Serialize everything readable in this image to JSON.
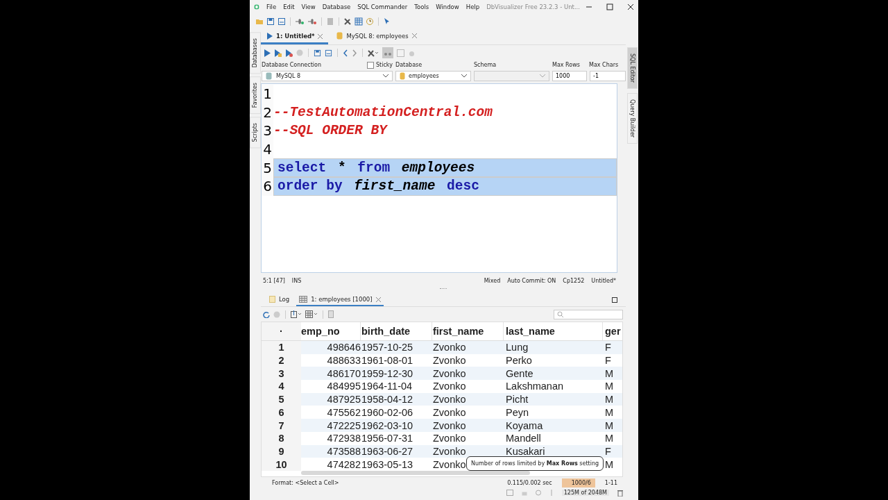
{
  "window": {
    "title": "DbVisualizer Free 23.2.3 - Unt..."
  },
  "menu": [
    "File",
    "Edit",
    "View",
    "Database",
    "SQL Commander",
    "Tools",
    "Window",
    "Help"
  ],
  "left_side_tabs": [
    {
      "label": "Databases",
      "selected": false
    },
    {
      "label": "Favorites",
      "selected": false
    },
    {
      "label": "Scripts",
      "selected": false
    }
  ],
  "right_side_tabs": [
    {
      "label": "SQL Editor",
      "selected": true
    },
    {
      "label": "Query Builder",
      "selected": false
    }
  ],
  "editor_tabs": [
    {
      "label": "1: Untitled*",
      "selected": true
    },
    {
      "label": "MySQL 8: employees",
      "selected": false
    }
  ],
  "connection": {
    "connection_label": "Database Connection",
    "connection_value": "MySQL 8",
    "sticky": {
      "label": "Sticky",
      "checked": false
    },
    "database_label": "Database",
    "database_value": "employees",
    "schema_label": "Schema",
    "max_rows_label": "Max Rows",
    "max_rows_value": "1000",
    "max_chars_label": "Max Chars",
    "max_chars_value": "-1"
  },
  "code_lines": [
    {
      "number": "1",
      "selected": false
    },
    {
      "number": "2",
      "selected": false,
      "tokens": [
        {
          "text": "--TestAutomationCentral.com",
          "kind": "comment"
        }
      ]
    },
    {
      "number": "3",
      "selected": false,
      "tokens": [
        {
          "text": "--SQL ORDER BY",
          "kind": "comment"
        }
      ]
    },
    {
      "number": "4",
      "selected": false
    },
    {
      "number": "5",
      "selected": true,
      "tokens": [
        {
          "text": "select",
          "kind": "keyword"
        },
        {
          "text": " * ",
          "kind": "plain"
        },
        {
          "text": "from",
          "kind": "keyword"
        },
        {
          "text": " employees",
          "kind": "identifier"
        }
      ]
    },
    {
      "number": "6",
      "selected": true,
      "tokens": [
        {
          "text": "order by",
          "kind": "keyword"
        },
        {
          "text": " first_name ",
          "kind": "identifier"
        },
        {
          "text": "desc",
          "kind": "keyword"
        }
      ]
    }
  ],
  "editor_status": {
    "left": [
      "5:1 [47]",
      "INS"
    ],
    "right": [
      "Mixed",
      "Auto Commit: ON",
      "Cp1252",
      "Untitled*"
    ]
  },
  "result_tabs": [
    {
      "label": "Log",
      "selected": false
    },
    {
      "label": "1: employees [1000]",
      "selected": true
    }
  ],
  "table": {
    "columns": [
      "·",
      "emp_no",
      "birth_date",
      "first_name",
      "last_name",
      "ger"
    ],
    "rows": [
      [
        "1",
        "498646",
        "1957-10-25",
        "Zvonko",
        "Lung",
        "F"
      ],
      [
        "2",
        "488633",
        "1961-08-01",
        "Zvonko",
        "Perko",
        "F"
      ],
      [
        "3",
        "486170",
        "1959-12-30",
        "Zvonko",
        "Gente",
        "M"
      ],
      [
        "4",
        "484995",
        "1964-11-04",
        "Zvonko",
        "Lakshmanan",
        "M"
      ],
      [
        "5",
        "487925",
        "1958-04-12",
        "Zvonko",
        "Picht",
        "M"
      ],
      [
        "6",
        "475562",
        "1960-02-06",
        "Zvonko",
        "Peyn",
        "M"
      ],
      [
        "7",
        "472225",
        "1962-03-10",
        "Zvonko",
        "Koyama",
        "M"
      ],
      [
        "8",
        "472938",
        "1956-07-31",
        "Zvonko",
        "Mandell",
        "M"
      ],
      [
        "9",
        "473588",
        "1963-06-27",
        "Zvonko",
        "Kusakari",
        "F"
      ],
      [
        "10",
        "474282",
        "1963-05-13",
        "Zvonko",
        "",
        "M"
      ]
    ]
  },
  "tooltip": "Number of rows limited by **Max Rows** setting",
  "status_bar": {
    "format": "Format: <Select a Cell>",
    "time": "0.115/0.002 sec",
    "row_count": "1000/6",
    "range": "1-11",
    "memory": "125M of 2048M"
  }
}
